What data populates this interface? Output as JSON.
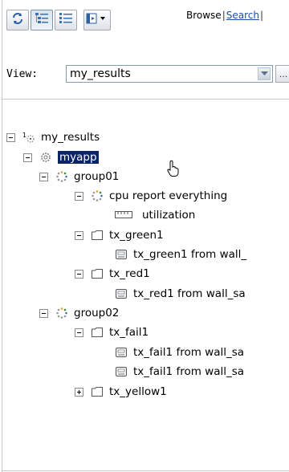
{
  "toolbar": {
    "buttons": [
      {
        "name": "refresh-button",
        "icon": "refresh-icon"
      },
      {
        "name": "tree-view-button",
        "icon": "tree-view-icon",
        "pressed": true
      },
      {
        "name": "list-view-button",
        "icon": "list-view-icon"
      },
      {
        "name": "view-options-menu-button",
        "icon": "view-options-icon"
      }
    ],
    "links": {
      "browse": "Browse",
      "separator": "|",
      "search": "Search",
      "trailing_separator": "|"
    }
  },
  "view_selector": {
    "label": "View:",
    "value": "my_results",
    "more_button": "..."
  },
  "tree": {
    "root": "my_results",
    "items": [
      {
        "label": "my_results",
        "icon": "results-root-icon",
        "toggle": "minus"
      },
      {
        "label": "myapp",
        "icon": "application-gear-icon",
        "toggle": "minus",
        "selected": true
      },
      {
        "label": "group01",
        "icon": "group-dots-icon",
        "toggle": "minus"
      },
      {
        "label": "cpu report everything",
        "icon": "group-dots-icon",
        "toggle": "minus"
      },
      {
        "label": "utilization",
        "icon": "metric-ruler-icon",
        "toggle": "none"
      },
      {
        "label": "tx_green1",
        "icon": "folder-icon",
        "toggle": "minus"
      },
      {
        "label": "tx_green1 from wall_",
        "icon": "report-icon",
        "toggle": "none"
      },
      {
        "label": "tx_red1",
        "icon": "folder-icon",
        "toggle": "minus"
      },
      {
        "label": "tx_red1 from wall_sa",
        "icon": "report-icon",
        "toggle": "none"
      },
      {
        "label": "group02",
        "icon": "group-dots-icon",
        "toggle": "minus"
      },
      {
        "label": "tx_fail1",
        "icon": "folder-icon",
        "toggle": "minus"
      },
      {
        "label": "tx_fail1 from wall_sa",
        "icon": "report-icon",
        "toggle": "none"
      },
      {
        "label": "tx_fail1 from wall_sa",
        "icon": "report-icon",
        "toggle": "none"
      },
      {
        "label": "tx_yellow1",
        "icon": "folder-icon",
        "toggle": "plus"
      }
    ]
  },
  "colors": {
    "selection_bg": "#0a246a",
    "link": "#1a4fa8",
    "border": "#c4c8cc"
  }
}
